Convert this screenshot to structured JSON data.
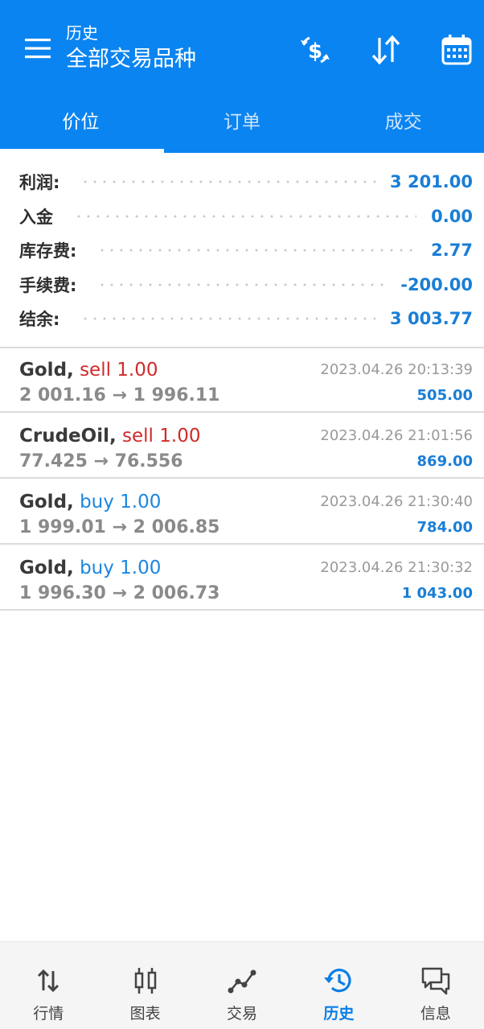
{
  "appbar": {
    "subtitle": "历史",
    "title": "全部交易品种"
  },
  "tabs": [
    {
      "label": "价位",
      "active": true
    },
    {
      "label": "订单",
      "active": false
    },
    {
      "label": "成交",
      "active": false
    }
  ],
  "summary": [
    {
      "label": "利润:",
      "value": "3 201.00"
    },
    {
      "label": "入金",
      "value": "0.00"
    },
    {
      "label": "库存费:",
      "value": "2.77"
    },
    {
      "label": "手续费:",
      "value": "-200.00"
    },
    {
      "label": "结余:",
      "value": "3 003.77"
    }
  ],
  "deals": [
    {
      "symbol": "Gold,",
      "side": "sell 1.00",
      "type": "sell",
      "prices": "2 001.16 → 1 996.11",
      "time": "2023.04.26 20:13:39",
      "profit": "505.00"
    },
    {
      "symbol": "CrudeOil,",
      "side": "sell 1.00",
      "type": "sell",
      "prices": "77.425 → 76.556",
      "time": "2023.04.26 21:01:56",
      "profit": "869.00"
    },
    {
      "symbol": "Gold,",
      "side": "buy 1.00",
      "type": "buy",
      "prices": "1 999.01 → 2 006.85",
      "time": "2023.04.26 21:30:40",
      "profit": "784.00"
    },
    {
      "symbol": "Gold,",
      "side": "buy 1.00",
      "type": "buy",
      "prices": "1 996.30 → 2 006.73",
      "time": "2023.04.26 21:30:32",
      "profit": "1 043.00"
    }
  ],
  "nav": [
    {
      "label": "行情",
      "icon": "quotes-icon",
      "active": false
    },
    {
      "label": "图表",
      "icon": "chart-icon",
      "active": false
    },
    {
      "label": "交易",
      "icon": "trade-icon",
      "active": false
    },
    {
      "label": "历史",
      "icon": "history-icon",
      "active": true
    },
    {
      "label": "信息",
      "icon": "messages-icon",
      "active": false
    }
  ],
  "colors": {
    "brand": "#0a84f0",
    "profit": "#1a7ed6",
    "sell": "#d02a2a",
    "buy": "#1b86e0"
  }
}
